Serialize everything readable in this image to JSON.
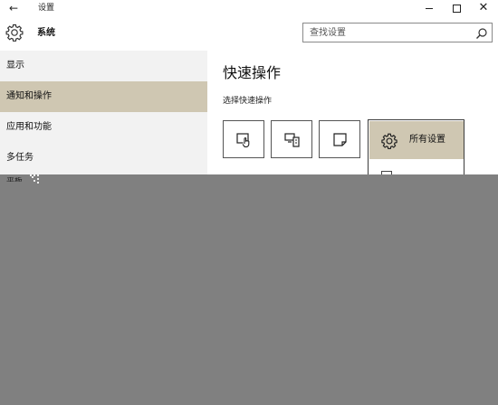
{
  "window": {
    "back_icon": "back-arrow-icon",
    "title": "设置",
    "minimize_icon": "minimize-icon",
    "maximize_icon": "maximize-icon",
    "close_icon": "close-icon"
  },
  "header": {
    "icon": "gear-icon",
    "title": "系统",
    "search": {
      "placeholder": "查找设置",
      "value": "",
      "icon": "search-icon"
    }
  },
  "sidebar": {
    "items": [
      {
        "label": "显示",
        "selected": false
      },
      {
        "label": "通知和操作",
        "selected": true
      },
      {
        "label": "应用和功能",
        "selected": false
      },
      {
        "label": "多任务",
        "selected": false
      },
      {
        "label": "平板",
        "selected": false
      }
    ]
  },
  "main": {
    "section_title": "快速操作",
    "section_subtitle": "选择快速操作",
    "tiles": [
      {
        "icon": "tablet-mode-icon"
      },
      {
        "icon": "project-icon"
      },
      {
        "icon": "note-icon"
      }
    ],
    "flyout": {
      "items": [
        {
          "label": "所有设置",
          "icon": "gear-icon",
          "selected": true
        }
      ]
    }
  },
  "colors": {
    "accent": "#cfc7b2",
    "sidebar_bg": "#f2f2f2",
    "overlay": "#808080"
  }
}
